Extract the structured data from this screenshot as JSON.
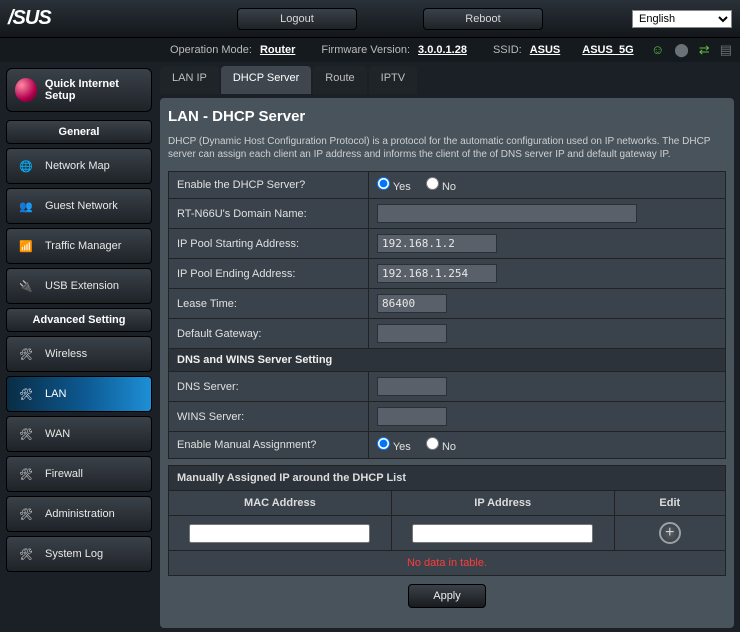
{
  "top": {
    "brand": "/SUS",
    "logout": "Logout",
    "reboot": "Reboot",
    "language": "English"
  },
  "info": {
    "op_mode_lbl": "Operation Mode:",
    "op_mode": "Router",
    "fw_lbl": "Firmware Version:",
    "fw": "3.0.0.1.28",
    "ssid_lbl": "SSID:",
    "ssid": "ASUS",
    "ssid5": "ASUS_5G"
  },
  "sidebar": {
    "qis": "Quick Internet Setup",
    "general": "General",
    "items_general": [
      "Network Map",
      "Guest Network",
      "Traffic Manager",
      "USB Extension"
    ],
    "advanced": "Advanced Setting",
    "items_adv": [
      "Wireless",
      "LAN",
      "WAN",
      "Firewall",
      "Administration",
      "System Log"
    ],
    "active": "LAN"
  },
  "tabs": {
    "list": [
      "LAN IP",
      "DHCP Server",
      "Route",
      "IPTV"
    ],
    "active": "DHCP Server"
  },
  "page": {
    "title": "LAN - DHCP Server",
    "desc": "DHCP (Dynamic Host Configuration Protocol) is a protocol for the automatic configuration used on IP networks. The DHCP server can assign each client an IP address and informs the client of the of DNS server IP and default gateway IP.",
    "rows": {
      "enable_dhcp": "Enable the DHCP Server?",
      "domain_name": "RT-N66U's Domain Name:",
      "pool_start": "IP Pool Starting Address:",
      "pool_end": "IP Pool Ending Address:",
      "lease": "Lease Time:",
      "gateway": "Default Gateway:",
      "dns_wins_hdr": "DNS and WINS Server Setting",
      "dns": "DNS Server:",
      "wins": "WINS Server:",
      "manual": "Enable Manual Assignment?",
      "manual_hdr": "Manually Assigned IP around the DHCP List",
      "col_mac": "MAC Address",
      "col_ip": "IP Address",
      "col_edit": "Edit",
      "no_data": "No data in table.",
      "apply": "Apply",
      "yes": "Yes",
      "no": "No"
    },
    "values": {
      "enable_dhcp": "Yes",
      "domain_name": "",
      "pool_start": "192.168.1.2",
      "pool_end": "192.168.1.254",
      "lease": "86400",
      "gateway": "",
      "dns": "",
      "wins": "",
      "manual": "Yes"
    }
  }
}
